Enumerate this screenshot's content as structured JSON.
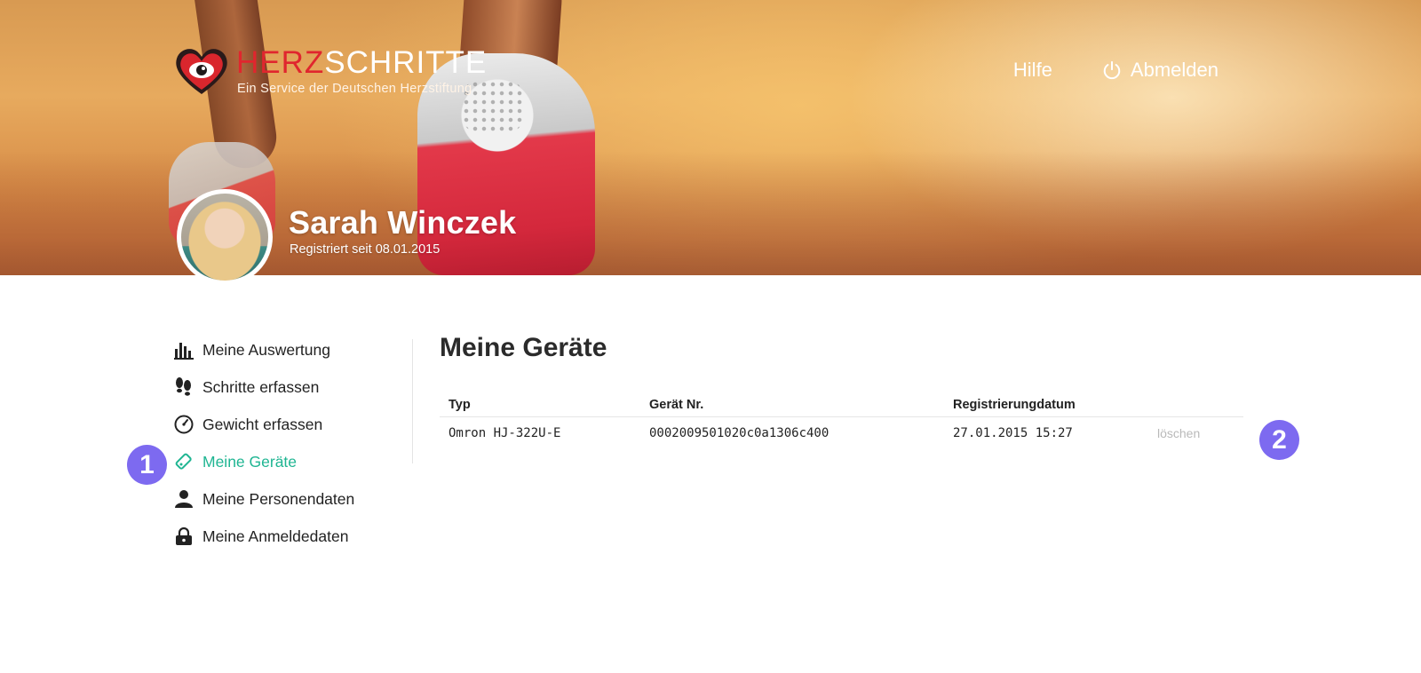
{
  "header": {
    "logo": {
      "title_part1": "HERZ",
      "title_part2": "SCHRITTE",
      "subtitle": "Ein Service der Deutschen Herzstiftung"
    },
    "nav": {
      "help": "Hilfe",
      "logout": "Abmelden"
    }
  },
  "profile": {
    "name": "Sarah Winczek",
    "registered": "Registriert seit 08.01.2015"
  },
  "sidebar": {
    "items": [
      {
        "label": "Meine Auswertung",
        "icon": "bar-chart-icon",
        "active": false
      },
      {
        "label": "Schritte erfassen",
        "icon": "footsteps-icon",
        "active": false
      },
      {
        "label": "Gewicht erfassen",
        "icon": "gauge-icon",
        "active": false
      },
      {
        "label": "Meine Geräte",
        "icon": "device-icon",
        "active": true
      },
      {
        "label": "Meine Personendaten",
        "icon": "person-icon",
        "active": false
      },
      {
        "label": "Meine Anmeldedaten",
        "icon": "lock-icon",
        "active": false
      }
    ]
  },
  "main": {
    "title": "Meine Geräte",
    "table": {
      "headers": [
        "Typ",
        "Gerät Nr.",
        "Registrierungdatum",
        ""
      ],
      "rows": [
        {
          "type": "Omron HJ-322U-E",
          "device_no": "0002009501020c0a1306c400",
          "date": "27.01.2015 15:27",
          "action": "löschen"
        }
      ]
    }
  },
  "annotations": {
    "badge1": "1",
    "badge2": "2"
  },
  "colors": {
    "accent": "#1fb592",
    "brand_red": "#e0262e",
    "badge": "#7d6af0"
  }
}
